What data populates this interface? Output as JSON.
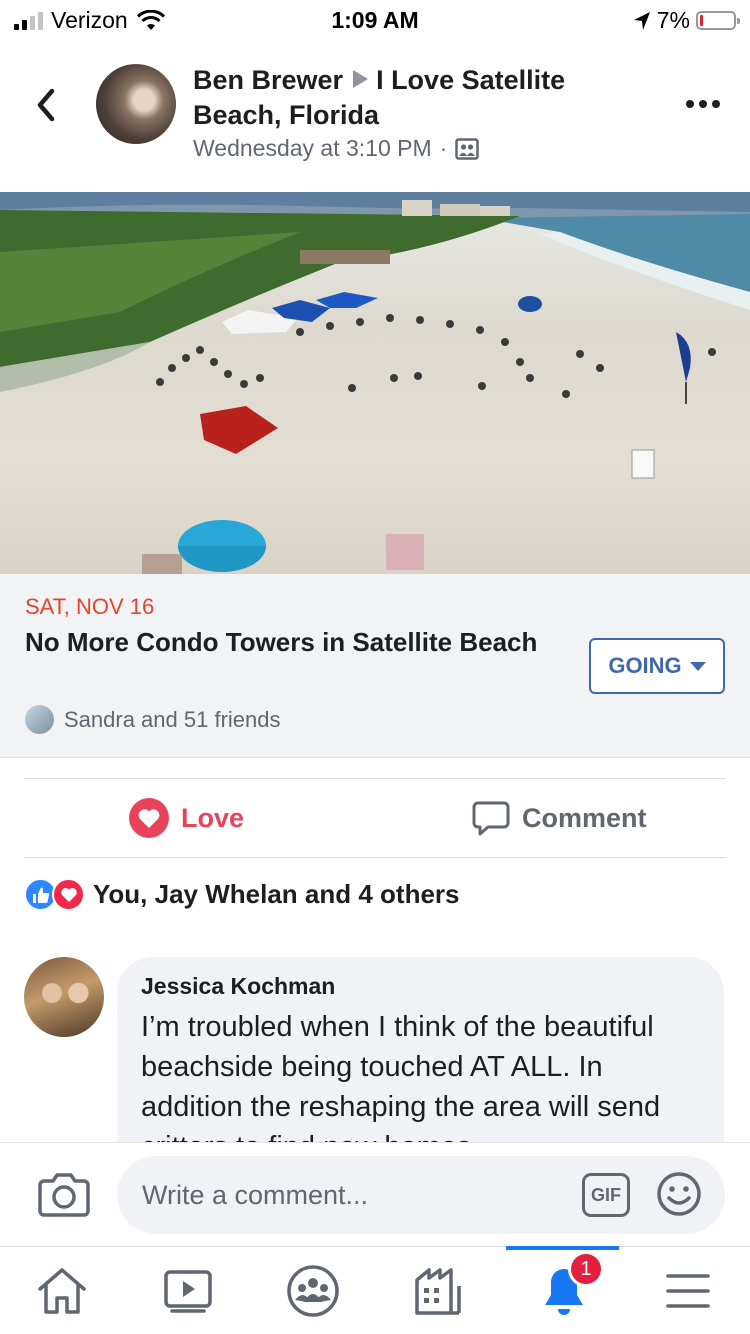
{
  "status_bar": {
    "carrier": "Verizon",
    "time": "1:09 AM",
    "battery": "7%",
    "battery_level": 0.07,
    "signal_bars_filled": 2,
    "signal_bars_total": 4
  },
  "post": {
    "author": "Ben Brewer",
    "group": "I Love Satellite Beach, Florida",
    "timestamp": "Wednesday at 3:10 PM",
    "separator": "·",
    "icons": {
      "back": "chevron-left-icon",
      "audience": "group-icon",
      "more": "more-icon"
    }
  },
  "event": {
    "date": "SAT, NOV 16",
    "title": "No More Condo Towers in Satellite Beach",
    "friends": "Sandra and 51 friends",
    "going_label": "GOING"
  },
  "actions": {
    "love_label": "Love",
    "comment_label": "Comment"
  },
  "reactions": {
    "summary": "You, Jay Whelan and 4 others"
  },
  "comment": {
    "author": "Jessica Kochman",
    "text": "I’m troubled when I think of the beautiful beachside being touched AT ALL. In addition the reshaping the area will send critters to find new homes."
  },
  "composer": {
    "placeholder": "Write a comment...",
    "gif_label": "GIF"
  },
  "tabbar": {
    "tabs": [
      "home-icon",
      "watch-icon",
      "groups-icon",
      "marketplace-icon",
      "notifications-icon",
      "menu-icon"
    ],
    "active": "notifications-icon",
    "notification_count": "1"
  },
  "colors": {
    "accent": "#4267b2",
    "love": "#e9435b",
    "event_date": "#e9432c",
    "badge": "#e41e3f"
  }
}
